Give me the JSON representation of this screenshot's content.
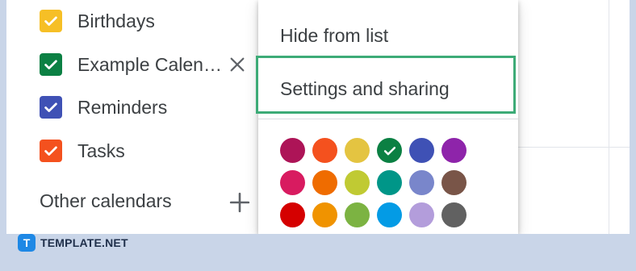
{
  "my_calendars": [
    {
      "label": "Birthdays",
      "color": "#f6bf26",
      "checked": true
    },
    {
      "label": "Example Calen…",
      "color": "#0b8043",
      "checked": true
    },
    {
      "label": "Reminders",
      "color": "#3f51b5",
      "checked": true
    },
    {
      "label": "Tasks",
      "color": "#f4511e",
      "checked": true
    }
  ],
  "other_calendars": {
    "label": "Other calendars"
  },
  "menu": {
    "hide_label": "Hide from list",
    "settings_label": "Settings and sharing",
    "highlight_color": "#3dab77"
  },
  "palette": [
    {
      "color": "#ad1457",
      "selected": false
    },
    {
      "color": "#f4511e",
      "selected": false
    },
    {
      "color": "#e4c441",
      "selected": false
    },
    {
      "color": "#0b8043",
      "selected": true
    },
    {
      "color": "#3f51b5",
      "selected": false
    },
    {
      "color": "#8e24aa",
      "selected": false
    },
    {
      "color": "#d81b60",
      "selected": false
    },
    {
      "color": "#ef6c00",
      "selected": false
    },
    {
      "color": "#c0ca33",
      "selected": false
    },
    {
      "color": "#009688",
      "selected": false
    },
    {
      "color": "#7986cb",
      "selected": false
    },
    {
      "color": "#795548",
      "selected": false
    },
    {
      "color": "#d50000",
      "selected": false
    },
    {
      "color": "#f09300",
      "selected": false
    },
    {
      "color": "#7cb342",
      "selected": false
    },
    {
      "color": "#039be5",
      "selected": false
    },
    {
      "color": "#b39ddb",
      "selected": false
    },
    {
      "color": "#616161",
      "selected": false
    }
  ],
  "watermark": {
    "mark": "T",
    "text": "TEMPLATE.NET"
  }
}
